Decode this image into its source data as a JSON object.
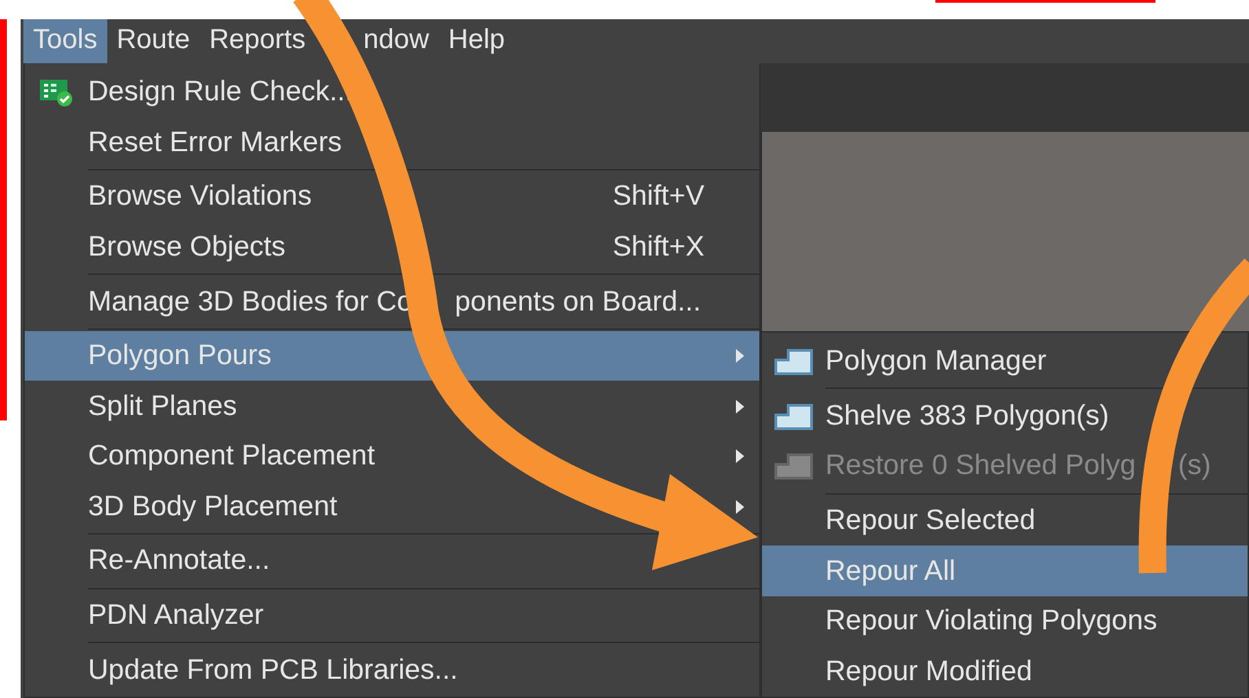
{
  "menubar": [
    {
      "label": "Tools",
      "selected": true,
      "partly_covered": false
    },
    {
      "label": "Route",
      "selected": false,
      "partly_covered": false
    },
    {
      "label": "Reports",
      "selected": false,
      "partly_covered": false
    },
    {
      "label": "ndow",
      "selected": false,
      "partly_covered": true
    },
    {
      "label": "Help",
      "selected": false,
      "partly_covered": false
    }
  ],
  "menu": {
    "items": [
      {
        "kind": "item",
        "label": "Design Rule Check...",
        "has_icon": true,
        "selected": false,
        "has_submenu": false
      },
      {
        "kind": "item",
        "label": "Reset Error Markers",
        "has_icon": false,
        "selected": false,
        "has_submenu": false
      },
      {
        "kind": "separator"
      },
      {
        "kind": "item",
        "label": "Browse Violations",
        "shortcut": "Shift+V",
        "has_icon": false,
        "selected": false,
        "has_submenu": false
      },
      {
        "kind": "item",
        "label": "Browse Objects",
        "shortcut": "Shift+X",
        "has_icon": false,
        "selected": false,
        "has_submenu": false
      },
      {
        "kind": "separator"
      },
      {
        "kind": "item",
        "label": "Manage 3D Bodies for Co",
        "label_rest": "ponents on Board...",
        "has_icon": false,
        "selected": false,
        "has_submenu": false
      },
      {
        "kind": "separator"
      },
      {
        "kind": "item",
        "label": "Polygon Pours",
        "has_icon": false,
        "selected": true,
        "has_submenu": true
      },
      {
        "kind": "item",
        "label": "Split Planes",
        "has_icon": false,
        "selected": false,
        "has_submenu": true
      },
      {
        "kind": "item",
        "label": "Component Placement",
        "has_icon": false,
        "selected": false,
        "has_submenu": true
      },
      {
        "kind": "item",
        "label": "3D Body Placement",
        "has_icon": false,
        "selected": false,
        "has_submenu": true
      },
      {
        "kind": "separator"
      },
      {
        "kind": "item",
        "label": "Re-Annotate...",
        "has_icon": false,
        "selected": false,
        "has_submenu": false
      },
      {
        "kind": "separator"
      },
      {
        "kind": "item",
        "label": "PDN Analyzer",
        "has_icon": false,
        "selected": false,
        "has_submenu": false
      },
      {
        "kind": "separator"
      },
      {
        "kind": "item",
        "label": "Update From PCB Libraries...",
        "has_icon": false,
        "selected": false,
        "has_submenu": false
      }
    ]
  },
  "submenu": {
    "items": [
      {
        "kind": "item",
        "label": "Polygon Manager",
        "has_icon": true,
        "disabled": false,
        "selected": false
      },
      {
        "kind": "separator"
      },
      {
        "kind": "item",
        "label": "Shelve 383 Polygon(s)",
        "has_icon": true,
        "disabled": false,
        "selected": false
      },
      {
        "kind": "item",
        "label": "Restore 0 Shelved Polyg",
        "label_rest": "(s)",
        "has_icon": true,
        "disabled": true,
        "selected": false
      },
      {
        "kind": "separator"
      },
      {
        "kind": "item",
        "label": "Repour Selected",
        "has_icon": false,
        "disabled": false,
        "selected": false
      },
      {
        "kind": "item",
        "label": "Repour All",
        "has_icon": false,
        "disabled": false,
        "selected": true
      },
      {
        "kind": "item",
        "label": "Repour Violating Polygons",
        "has_icon": false,
        "disabled": false,
        "selected": false
      },
      {
        "kind": "item",
        "label": "Repour Modified",
        "has_icon": false,
        "disabled": false,
        "selected": false
      }
    ]
  }
}
